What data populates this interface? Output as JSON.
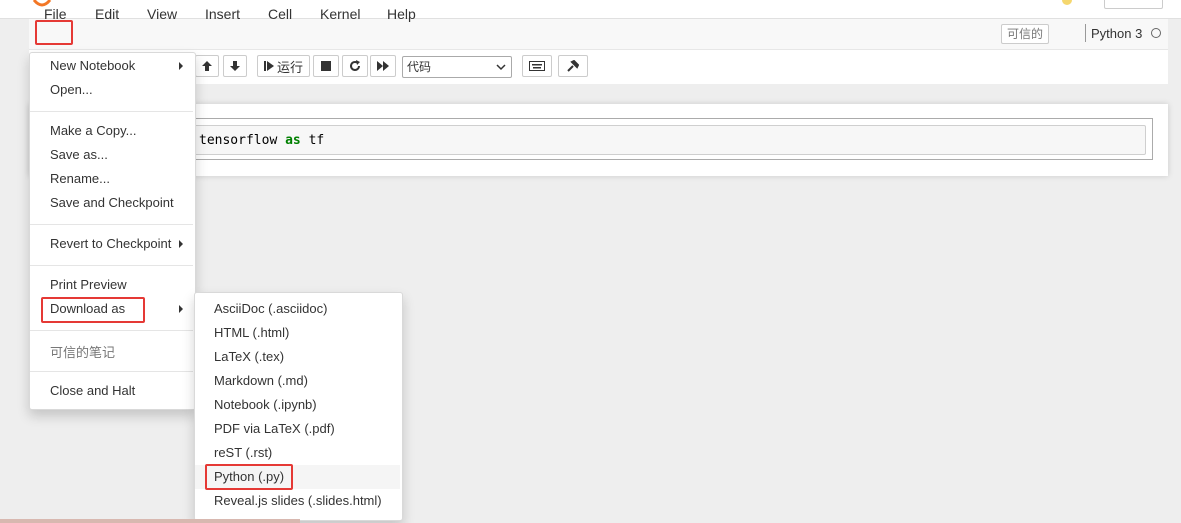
{
  "menubar": {
    "file": "File",
    "edit": "Edit",
    "view": "View",
    "insert": "Insert",
    "cell": "Cell",
    "kernel": "Kernel",
    "help": "Help"
  },
  "header": {
    "trusted": "可信的",
    "kernel_name": "Python 3"
  },
  "toolbar": {
    "run_label": "运行",
    "cell_type": "代码"
  },
  "cell": {
    "code_prefix": "tensorflow ",
    "code_keyword": "as",
    "code_suffix": " tf"
  },
  "file_menu": {
    "new_notebook": "New Notebook",
    "open": "Open...",
    "make_copy": "Make a Copy...",
    "save_as": "Save as...",
    "rename": "Rename...",
    "save_checkpoint": "Save and Checkpoint",
    "revert_checkpoint": "Revert to Checkpoint",
    "print_preview": "Print Preview",
    "download_as": "Download as",
    "trusted_notebook": "可信的笔记",
    "close_halt": "Close and Halt"
  },
  "download_menu": {
    "items": [
      "AsciiDoc (.asciidoc)",
      "HTML (.html)",
      "LaTeX (.tex)",
      "Markdown (.md)",
      "Notebook (.ipynb)",
      "PDF via LaTeX (.pdf)",
      "reST (.rst)",
      "Python (.py)",
      "Reveal.js slides (.slides.html)"
    ]
  },
  "colors": {
    "highlight": "#e53935",
    "keyword": "#008000",
    "logo": "#f37726"
  },
  "icons": [
    "logo-icon",
    "user-icon",
    "arrow-up-icon",
    "arrow-down-icon",
    "step-forward-icon",
    "stop-icon",
    "restart-icon",
    "fast-forward-icon",
    "keyboard-icon",
    "wrench-icon",
    "chevron-down-icon",
    "caret-right-icon",
    "kernel-status-icon"
  ]
}
